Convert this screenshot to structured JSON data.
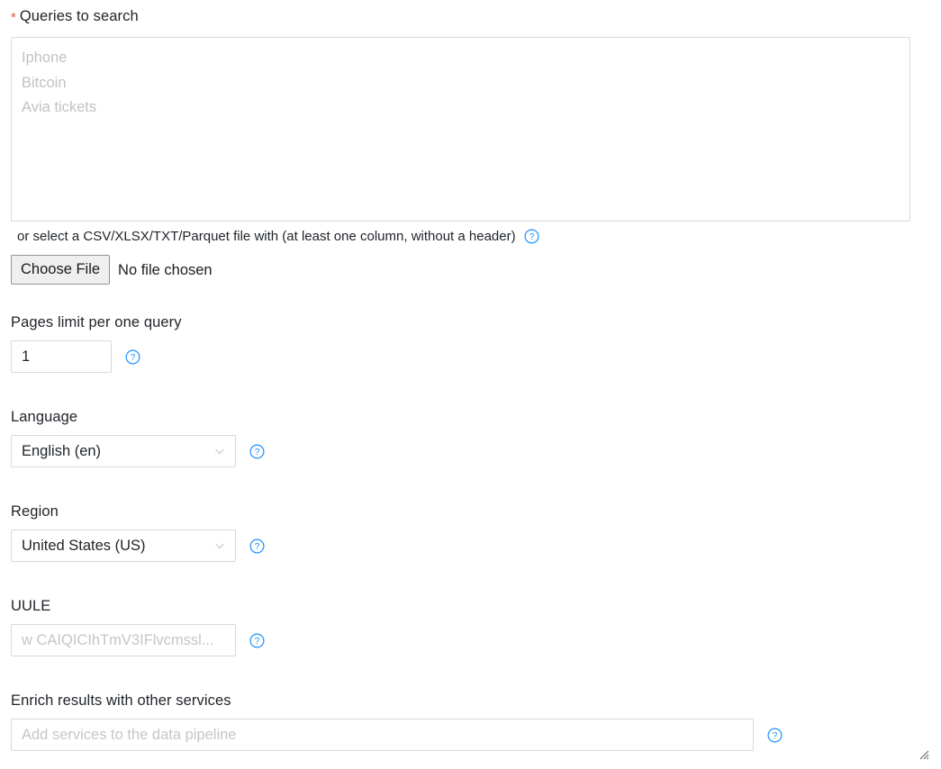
{
  "form": {
    "queries": {
      "label": "Queries to search",
      "required_marker": "*",
      "placeholder": "Iphone\nBitcoin\nAvia tickets",
      "value": ""
    },
    "file": {
      "hint": "or select a CSV/XLSX/TXT/Parquet file with (at least one column, without a header)",
      "button_label": "Choose File",
      "status": "No file chosen",
      "help_icon": "help-circle-icon"
    },
    "pages_limit": {
      "label": "Pages limit per one query",
      "value": "1",
      "help_icon": "help-circle-icon"
    },
    "language": {
      "label": "Language",
      "value": "English (en)",
      "chevron_icon": "chevron-down-icon",
      "help_icon": "help-circle-icon"
    },
    "region": {
      "label": "Region",
      "value": "United States (US)",
      "chevron_icon": "chevron-down-icon",
      "help_icon": "help-circle-icon"
    },
    "uule": {
      "label": "UULE",
      "placeholder": "w CAIQICIhTmV3IFlvcmssl...",
      "value": "",
      "help_icon": "help-circle-icon"
    },
    "enrich": {
      "label": "Enrich results with other services",
      "placeholder": "Add services to the data pipeline",
      "value": "",
      "help_icon": "help-circle-icon"
    }
  },
  "colors": {
    "required_asterisk": "#e8553b",
    "help_icon": "#1890ff",
    "border": "#d9d9d9",
    "text": "#212529",
    "placeholder": "#c3c6c9"
  }
}
